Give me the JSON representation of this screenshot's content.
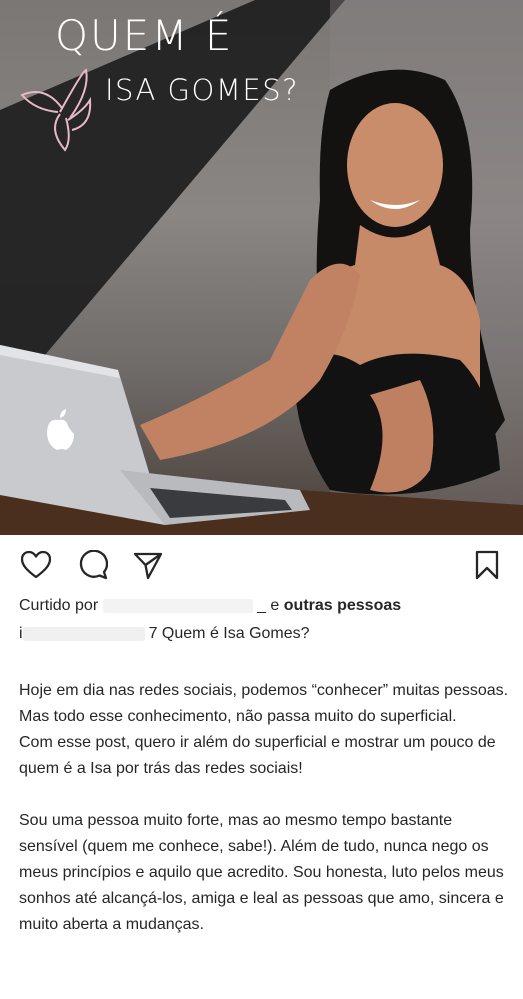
{
  "post": {
    "overlay_title": "QUEM É",
    "overlay_subtitle": "ISA GOMES?",
    "liked_prefix": "Curtido por",
    "liked_redacted_suffix": "_ e",
    "liked_suffix": "outras pessoas",
    "caption_user_redacted": "i",
    "caption_user_tail": "7",
    "caption_title": "Quem é Isa Gomes?",
    "paragraphs": [
      "Hoje em dia nas redes sociais, podemos “conhecer” muitas pessoas. Mas todo esse conhecimento, não passa muito do superficial.",
      "Com esse post, quero ir além do superficial e mostrar um pouco de quem é a Isa por trás das redes sociais!",
      "",
      "Sou uma pessoa muito forte, mas ao mesmo tempo bastante sensível (quem me conhece, sabe!). Além de tudo, nunca nego os meus princípios e aquilo que acredito. Sou honesta, luto pelos meus sonhos até alcançá-los, amiga e leal as pessoas que amo, sincera e muito aberta a mudanças."
    ]
  },
  "icons": {
    "like": "heart-icon",
    "comment": "comment-bubble-icon",
    "share": "paper-plane-icon",
    "save": "bookmark-icon",
    "butterfly": "butterfly-logo-icon",
    "laptop_logo": "apple-logo-icon"
  },
  "colors": {
    "text": "#262626",
    "overlay_text": "#ffffff",
    "butterfly": "#e8b8c8"
  }
}
